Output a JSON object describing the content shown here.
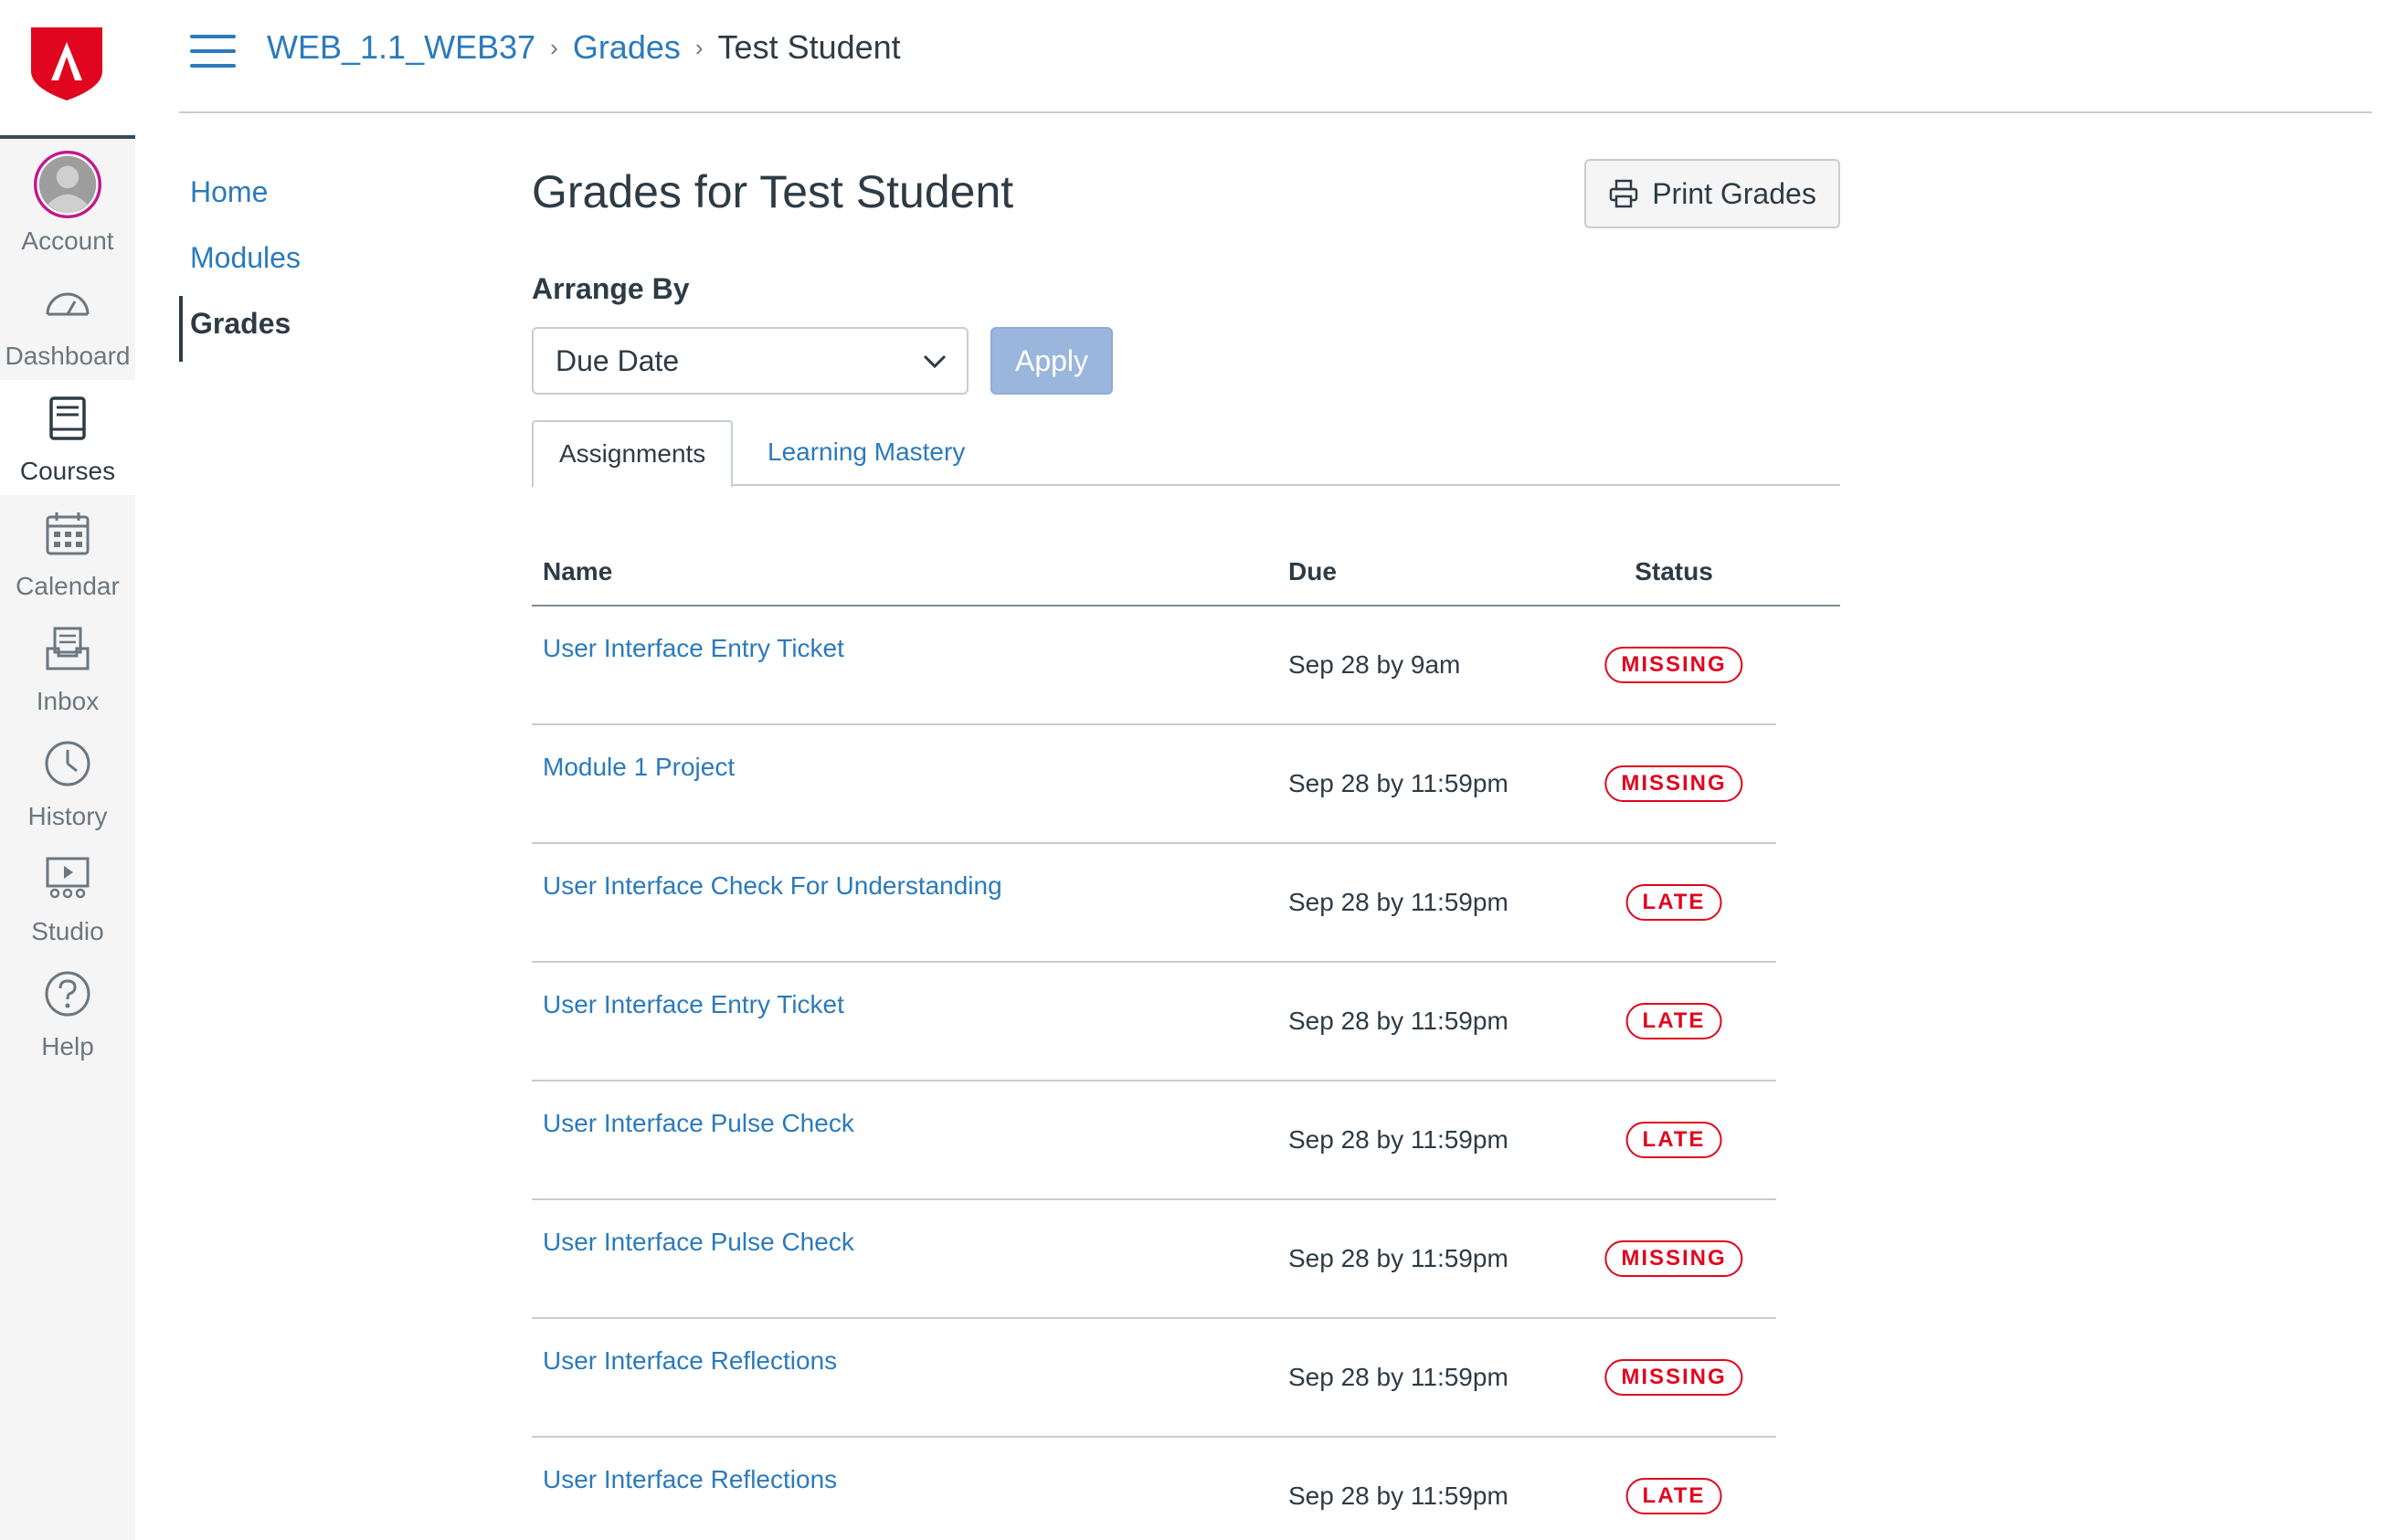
{
  "global_nav": {
    "items": [
      {
        "label": "Account",
        "icon": "avatar-icon"
      },
      {
        "label": "Dashboard",
        "icon": "dashboard-icon"
      },
      {
        "label": "Courses",
        "icon": "courses-icon",
        "active": true
      },
      {
        "label": "Calendar",
        "icon": "calendar-icon"
      },
      {
        "label": "Inbox",
        "icon": "inbox-icon"
      },
      {
        "label": "History",
        "icon": "history-icon"
      },
      {
        "label": "Studio",
        "icon": "studio-icon"
      },
      {
        "label": "Help",
        "icon": "help-icon"
      }
    ]
  },
  "header": {
    "breadcrumb": [
      "WEB_1.1_WEB37",
      "Grades",
      "Test Student"
    ]
  },
  "course_nav": {
    "items": [
      "Home",
      "Modules",
      "Grades"
    ],
    "active": "Grades"
  },
  "main": {
    "title": "Grades for Test Student",
    "print_label": "Print Grades",
    "arrange_label": "Arrange By",
    "arrange_value": "Due Date",
    "apply_label": "Apply",
    "tabs": [
      "Assignments",
      "Learning Mastery"
    ],
    "table": {
      "headers": [
        "Name",
        "Due",
        "Status"
      ],
      "rows": [
        {
          "name": "User Interface Entry Ticket",
          "due": "Sep 28 by 9am",
          "status": "MISSING"
        },
        {
          "name": "Module 1 Project",
          "due": "Sep 28 by 11:59pm",
          "status": "MISSING"
        },
        {
          "name": "User Interface Check For Understanding",
          "due": "Sep 28 by 11:59pm",
          "status": "LATE"
        },
        {
          "name": "User Interface Entry Ticket",
          "due": "Sep 28 by 11:59pm",
          "status": "LATE"
        },
        {
          "name": "User Interface Pulse Check",
          "due": "Sep 28 by 11:59pm",
          "status": "LATE"
        },
        {
          "name": "User Interface Pulse Check",
          "due": "Sep 28 by 11:59pm",
          "status": "MISSING"
        },
        {
          "name": "User Interface Reflections",
          "due": "Sep 28 by 11:59pm",
          "status": "MISSING"
        },
        {
          "name": "User Interface Reflections",
          "due": "Sep 28 by 11:59pm",
          "status": "LATE"
        }
      ]
    }
  },
  "colors": {
    "link": "#2b7abc",
    "text": "#2d3b45",
    "status": "#e0061f",
    "logo": "#e0061f",
    "apply_disabled": "#9bb6dd"
  }
}
